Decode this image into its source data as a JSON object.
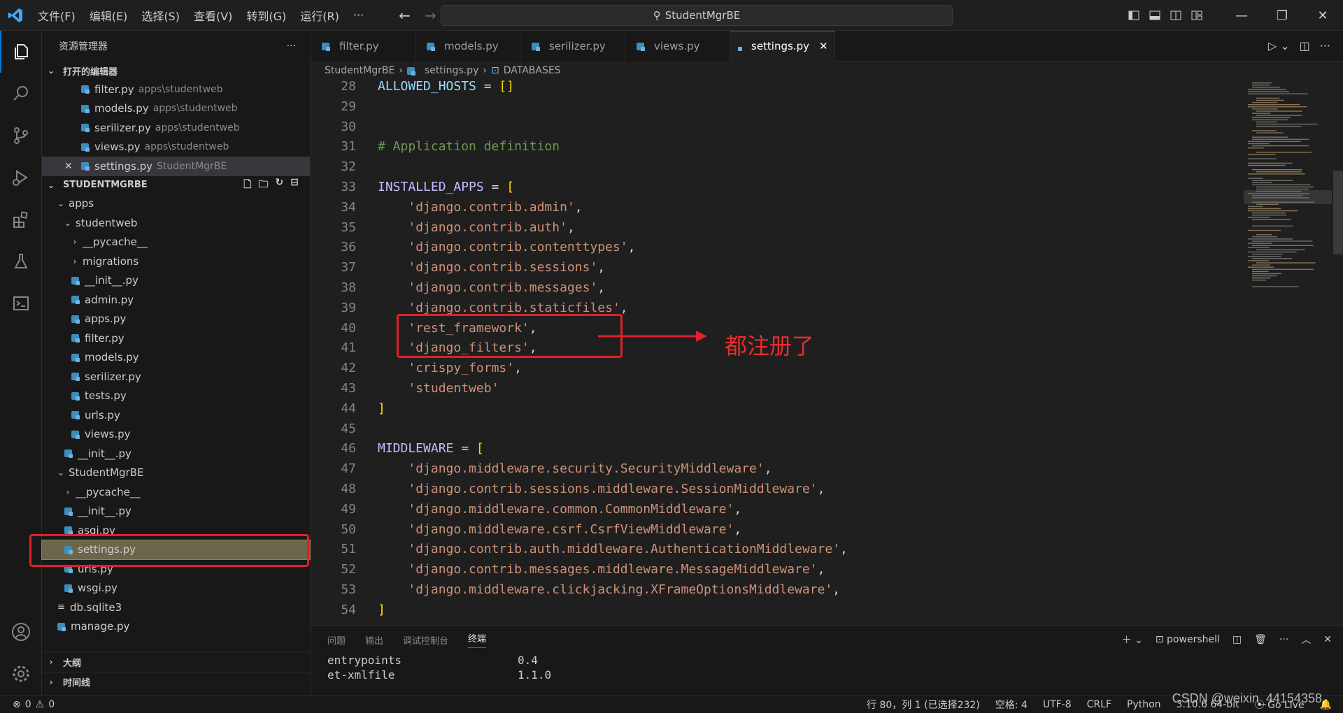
{
  "titlebar": {
    "menu": [
      "文件(F)",
      "编辑(E)",
      "选择(S)",
      "查看(V)",
      "转到(G)",
      "运行(R)",
      "···"
    ],
    "search": "StudentMgrBE"
  },
  "sidebar": {
    "title": "资源管理器",
    "more": "···",
    "open_editors_label": "打开的编辑器",
    "open_editors": [
      {
        "name": "filter.py",
        "desc": "apps\\studentweb"
      },
      {
        "name": "models.py",
        "desc": "apps\\studentweb"
      },
      {
        "name": "serilizer.py",
        "desc": "apps\\studentweb"
      },
      {
        "name": "views.py",
        "desc": "apps\\studentweb"
      },
      {
        "name": "settings.py",
        "desc": "StudentMgrBE"
      }
    ],
    "project_label": "STUDENTMGRBE",
    "tree": {
      "apps": "apps",
      "studentweb": "studentweb",
      "pycache1": "__pycache__",
      "migrations": "migrations",
      "init1": "__init__.py",
      "admin": "admin.py",
      "appspy": "apps.py",
      "filter": "filter.py",
      "models": "models.py",
      "serilizer": "serilizer.py",
      "tests": "tests.py",
      "urls1": "urls.py",
      "views": "views.py",
      "init2": "__init__.py",
      "studentmgrbe": "StudentMgrBE",
      "pycache2": "__pycache__",
      "init3": "__init__.py",
      "asgi": "asgi.py",
      "settings": "settings.py",
      "urls2": "urls.py",
      "wsgi": "wsgi.py",
      "db": "db.sqlite3",
      "manage": "manage.py"
    },
    "outline_label": "大纲",
    "timeline_label": "时间线"
  },
  "tabs": [
    {
      "label": "filter.py"
    },
    {
      "label": "models.py"
    },
    {
      "label": "serilizer.py"
    },
    {
      "label": "views.py"
    },
    {
      "label": "settings.py",
      "close": "✕"
    }
  ],
  "breadcrumb": {
    "project": "StudentMgrBE",
    "file": "settings.py",
    "symbol": "DATABASES"
  },
  "code": [
    {
      "n": "28",
      "parts": [
        [
          "var",
          "ALLOWED_HOSTS"
        ],
        [
          "punc",
          " = "
        ],
        [
          "brk",
          "[]"
        ]
      ]
    },
    {
      "n": "29",
      "parts": []
    },
    {
      "n": "30",
      "parts": []
    },
    {
      "n": "31",
      "parts": [
        [
          "cmt",
          "# Application definition"
        ]
      ]
    },
    {
      "n": "32",
      "parts": []
    },
    {
      "n": "33",
      "parts": [
        [
          "const",
          "INSTALLED_APPS"
        ],
        [
          "punc",
          " = "
        ],
        [
          "brk",
          "["
        ]
      ]
    },
    {
      "n": "34",
      "parts": [
        [
          "punc",
          "    "
        ],
        [
          "str",
          "'django.contrib.admin'"
        ],
        [
          "punc",
          ","
        ]
      ]
    },
    {
      "n": "35",
      "parts": [
        [
          "punc",
          "    "
        ],
        [
          "str",
          "'django.contrib.auth'"
        ],
        [
          "punc",
          ","
        ]
      ]
    },
    {
      "n": "36",
      "parts": [
        [
          "punc",
          "    "
        ],
        [
          "str",
          "'django.contrib.contenttypes'"
        ],
        [
          "punc",
          ","
        ]
      ]
    },
    {
      "n": "37",
      "parts": [
        [
          "punc",
          "    "
        ],
        [
          "str",
          "'django.contrib.sessions'"
        ],
        [
          "punc",
          ","
        ]
      ]
    },
    {
      "n": "38",
      "parts": [
        [
          "punc",
          "    "
        ],
        [
          "str",
          "'django.contrib.messages'"
        ],
        [
          "punc",
          ","
        ]
      ]
    },
    {
      "n": "39",
      "parts": [
        [
          "punc",
          "    "
        ],
        [
          "str",
          "'django.contrib.staticfiles'"
        ],
        [
          "punc",
          ","
        ]
      ]
    },
    {
      "n": "40",
      "parts": [
        [
          "punc",
          "    "
        ],
        [
          "str",
          "'rest_framework'"
        ],
        [
          "punc",
          ","
        ]
      ]
    },
    {
      "n": "41",
      "parts": [
        [
          "punc",
          "    "
        ],
        [
          "str",
          "'django_filters'"
        ],
        [
          "punc",
          ","
        ]
      ]
    },
    {
      "n": "42",
      "parts": [
        [
          "punc",
          "    "
        ],
        [
          "str",
          "'crispy_forms'"
        ],
        [
          "punc",
          ","
        ]
      ]
    },
    {
      "n": "43",
      "parts": [
        [
          "punc",
          "    "
        ],
        [
          "str",
          "'studentweb'"
        ]
      ]
    },
    {
      "n": "44",
      "parts": [
        [
          "brk",
          "]"
        ]
      ]
    },
    {
      "n": "45",
      "parts": []
    },
    {
      "n": "46",
      "parts": [
        [
          "const",
          "MIDDLEWARE"
        ],
        [
          "punc",
          " = "
        ],
        [
          "brk",
          "["
        ]
      ]
    },
    {
      "n": "47",
      "parts": [
        [
          "punc",
          "    "
        ],
        [
          "str",
          "'django.middleware.security.SecurityMiddleware'"
        ],
        [
          "punc",
          ","
        ]
      ]
    },
    {
      "n": "48",
      "parts": [
        [
          "punc",
          "    "
        ],
        [
          "str",
          "'django.contrib.sessions.middleware.SessionMiddleware'"
        ],
        [
          "punc",
          ","
        ]
      ]
    },
    {
      "n": "49",
      "parts": [
        [
          "punc",
          "    "
        ],
        [
          "str",
          "'django.middleware.common.CommonMiddleware'"
        ],
        [
          "punc",
          ","
        ]
      ]
    },
    {
      "n": "50",
      "parts": [
        [
          "punc",
          "    "
        ],
        [
          "str",
          "'django.middleware.csrf.CsrfViewMiddleware'"
        ],
        [
          "punc",
          ","
        ]
      ]
    },
    {
      "n": "51",
      "parts": [
        [
          "punc",
          "    "
        ],
        [
          "str",
          "'django.contrib.auth.middleware.AuthenticationMiddleware'"
        ],
        [
          "punc",
          ","
        ]
      ]
    },
    {
      "n": "52",
      "parts": [
        [
          "punc",
          "    "
        ],
        [
          "str",
          "'django.contrib.messages.middleware.MessageMiddleware'"
        ],
        [
          "punc",
          ","
        ]
      ]
    },
    {
      "n": "53",
      "parts": [
        [
          "punc",
          "    "
        ],
        [
          "str",
          "'django.middleware.clickjacking.XFrameOptionsMiddleware'"
        ],
        [
          "punc",
          ","
        ]
      ]
    },
    {
      "n": "54",
      "parts": [
        [
          "brk",
          "]"
        ]
      ]
    }
  ],
  "annotation": "都注册了",
  "panel": {
    "tabs": [
      "问题",
      "输出",
      "调试控制台",
      "终端"
    ],
    "shell": "powershell",
    "lines": [
      {
        "name": "entrypoints",
        "version": "0.4"
      },
      {
        "name": "et-xmlfile",
        "version": "1.1.0"
      }
    ]
  },
  "status": {
    "errors": "0",
    "warnings": "0",
    "position": "行 80，列 1 (已选择232)",
    "spaces": "空格: 4",
    "encoding": "UTF-8",
    "eol": "CRLF",
    "language": "Python",
    "interpreter": "3.10.6 64-bit",
    "golive": "Go Live"
  },
  "watermark": "CSDN @weixin_44154358",
  "colors": {
    "accent": "#0078d4",
    "annotation": "#e0202a"
  }
}
